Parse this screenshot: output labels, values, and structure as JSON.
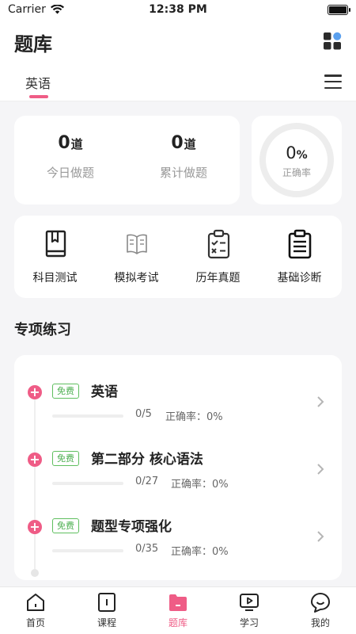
{
  "status_bar": {
    "carrier": "Carrier",
    "time": "12:38 PM"
  },
  "header": {
    "title": "题库"
  },
  "tabs": {
    "items": [
      {
        "label": "英语",
        "active": true
      }
    ]
  },
  "stats": [
    {
      "value": "0",
      "unit": "道",
      "label": "今日做题"
    },
    {
      "value": "0",
      "unit": "道",
      "label": "累计做题"
    }
  ],
  "accuracy": {
    "value": "0",
    "unit": "%",
    "label": "正确率",
    "fraction": 0
  },
  "shortcuts": [
    {
      "label": "科目测试",
      "icon": "book-icon"
    },
    {
      "label": "模拟考试",
      "icon": "open-book-icon"
    },
    {
      "label": "历年真题",
      "icon": "checklist-clipboard-icon"
    },
    {
      "label": "基础诊断",
      "icon": "document-clipboard-icon"
    }
  ],
  "section": {
    "title": "专项练习"
  },
  "practice_items": [
    {
      "badge": "免费",
      "name": "英语",
      "progress_text": "0/5",
      "accuracy_text": "正确率：0%",
      "progress": 0
    },
    {
      "badge": "免费",
      "name": "第二部分 核心语法",
      "progress_text": "0/27",
      "accuracy_text": "正确率：0%",
      "progress": 0
    },
    {
      "badge": "免费",
      "name": "题型专项强化",
      "progress_text": "0/35",
      "accuracy_text": "正确率：0%",
      "progress": 0
    }
  ],
  "tabbar": [
    {
      "label": "首页",
      "icon": "home-icon",
      "active": false
    },
    {
      "label": "课程",
      "icon": "course-icon",
      "active": false
    },
    {
      "label": "题库",
      "icon": "folder-icon",
      "active": true
    },
    {
      "label": "学习",
      "icon": "play-icon",
      "active": false
    },
    {
      "label": "我的",
      "icon": "profile-icon",
      "active": false
    }
  ],
  "colors": {
    "accent": "#ef5c86",
    "badge_green": "#4caf50",
    "background": "#f5f5f7"
  }
}
